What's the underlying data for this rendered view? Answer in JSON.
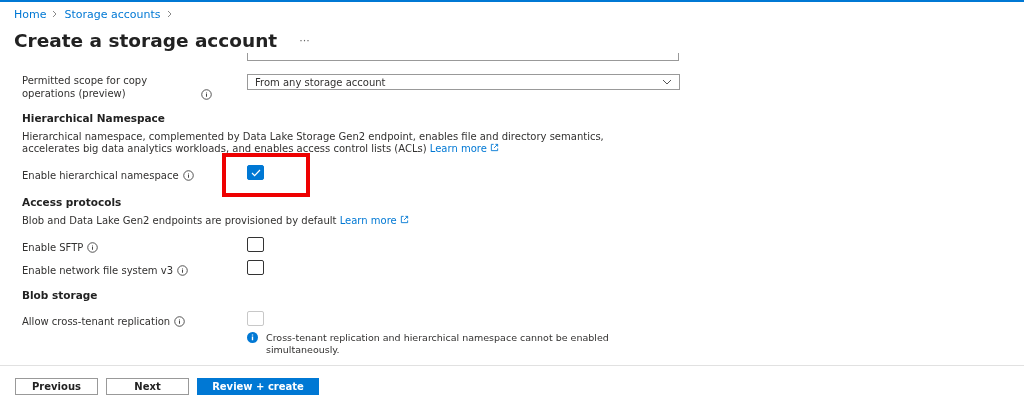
{
  "breadcrumb": [
    "Home",
    "Storage accounts"
  ],
  "title": "Create a storage account",
  "title_more": "···",
  "copy_scope": {
    "label": "Permitted scope for copy operations (preview)",
    "value": "From any storage account"
  },
  "sections": [
    {
      "heading": "Hierarchical Namespace",
      "description": "Hierarchical namespace, complemented by Data Lake Storage Gen2 endpoint, enables file and directory semantics, accelerates big data analytics workloads, and enables access control lists (ACLs)",
      "link": "Learn more",
      "options": [
        {
          "label": "Enable hierarchical namespace",
          "checked": true,
          "disabled": false,
          "highlighted": true
        }
      ]
    },
    {
      "heading": "Access protocols",
      "description": "Blob and Data Lake Gen2 endpoints are provisioned by default",
      "link": "Learn more",
      "options": [
        {
          "label": "Enable SFTP",
          "checked": false,
          "disabled": false,
          "highlighted": false
        },
        {
          "label": "Enable network file system v3",
          "checked": false,
          "disabled": false,
          "highlighted": false
        }
      ]
    },
    {
      "heading": "Blob storage",
      "options": [
        {
          "label": "Allow cross-tenant replication",
          "checked": false,
          "disabled": true,
          "highlighted": false,
          "note": "Cross-tenant replication and hierarchical namespace cannot be enabled simultaneously."
        }
      ]
    }
  ],
  "buttons": [
    {
      "label": "Previous",
      "primary": false
    },
    {
      "label": "Next",
      "primary": false
    },
    {
      "label": "Review + create",
      "primary": true
    }
  ]
}
